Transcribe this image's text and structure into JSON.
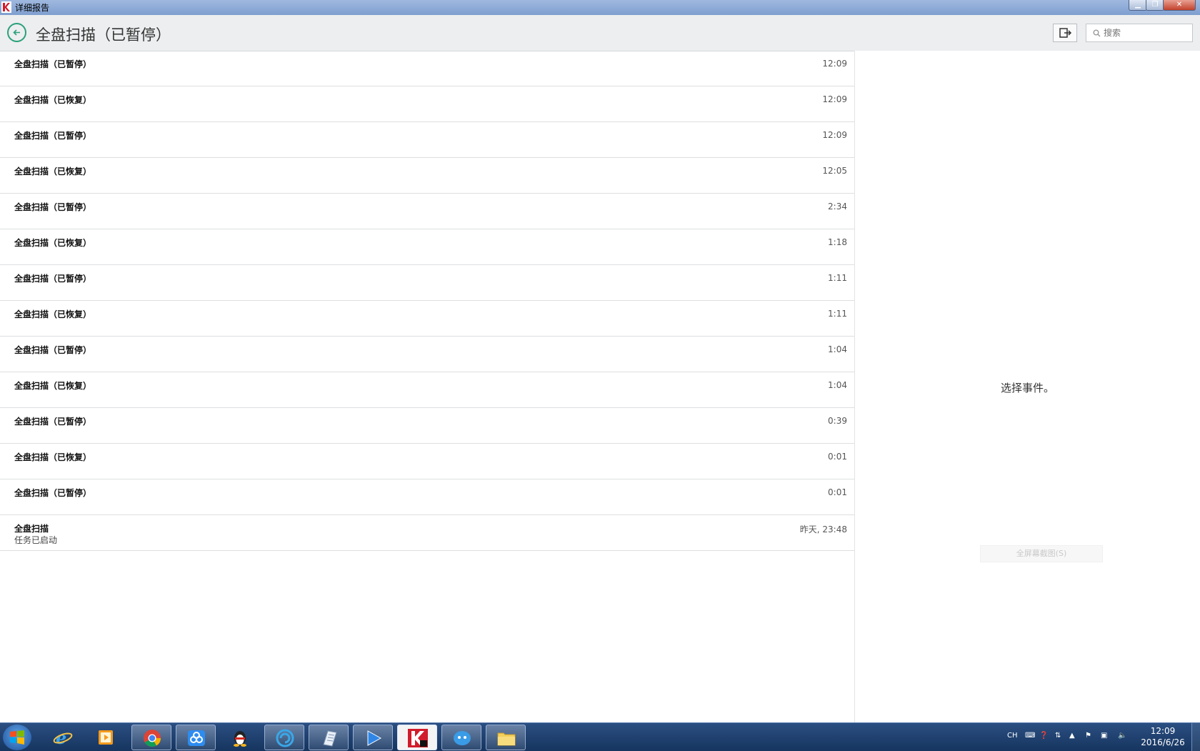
{
  "window": {
    "title": "详细报告"
  },
  "header": {
    "title": "全盘扫描（已暂停）",
    "search_placeholder": "搜索"
  },
  "events": [
    {
      "title": "全盘扫描（已暂停）",
      "subtitle": "",
      "time": "12:09"
    },
    {
      "title": "全盘扫描（已恢复）",
      "subtitle": "",
      "time": "12:09"
    },
    {
      "title": "全盘扫描（已暂停）",
      "subtitle": "",
      "time": "12:09"
    },
    {
      "title": "全盘扫描（已恢复）",
      "subtitle": "",
      "time": "12:05"
    },
    {
      "title": "全盘扫描（已暂停）",
      "subtitle": "",
      "time": "2:34"
    },
    {
      "title": "全盘扫描（已恢复）",
      "subtitle": "",
      "time": "1:18"
    },
    {
      "title": "全盘扫描（已暂停）",
      "subtitle": "",
      "time": "1:11"
    },
    {
      "title": "全盘扫描（已恢复）",
      "subtitle": "",
      "time": "1:11"
    },
    {
      "title": "全盘扫描（已暂停）",
      "subtitle": "",
      "time": "1:04"
    },
    {
      "title": "全盘扫描（已恢复）",
      "subtitle": "",
      "time": "1:04"
    },
    {
      "title": "全盘扫描（已暂停）",
      "subtitle": "",
      "time": "0:39"
    },
    {
      "title": "全盘扫描（已恢复）",
      "subtitle": "",
      "time": "0:01"
    },
    {
      "title": "全盘扫描（已暂停）",
      "subtitle": "",
      "time": "0:01"
    },
    {
      "title": "全盘扫描",
      "subtitle": "任务已启动",
      "time": "昨天, 23:48"
    }
  ],
  "detail": {
    "empty_message": "选择事件。",
    "screenshot_button": "全屏幕截图(S)"
  },
  "taskbar": {
    "apps": [
      "internet-explorer",
      "media-player",
      "chrome",
      "baidu-netdisk",
      "qq",
      "browser-360",
      "notepad",
      "video-player",
      "kaspersky",
      "chat-app",
      "file-explorer"
    ],
    "tray_language": "CH",
    "clock_time": "12:09",
    "clock_date": "2016/6/26"
  },
  "colors": {
    "accent": "#2aa079",
    "taskbar": "#1f3f6e"
  }
}
